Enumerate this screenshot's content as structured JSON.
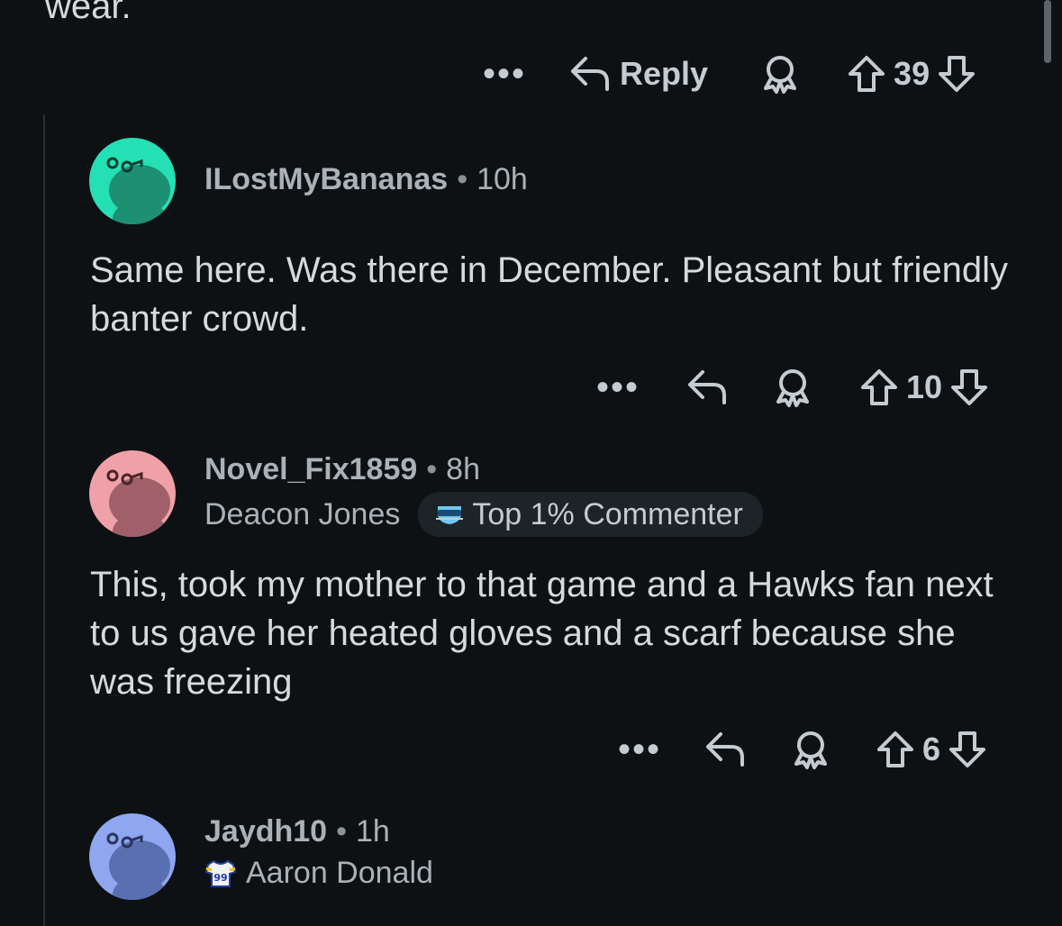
{
  "top_fragment": {
    "text": "wear."
  },
  "comments": [
    {
      "actions": {
        "more": "•••",
        "reply": "Reply",
        "votes": "39"
      }
    },
    {
      "username": "ILostMyBananas",
      "separator": "•",
      "time": "10h",
      "avatar_color": "#24e0b4",
      "body": "Same here. Was there in December. Pleasant but friendly banter crowd.",
      "actions": {
        "more": "•••",
        "votes": "10"
      }
    },
    {
      "username": "Novel_Fix1859",
      "separator": "•",
      "time": "8h",
      "flair": "Deacon Jones",
      "badge": "Top 1% Commenter",
      "avatar_color": "#f0a0a8",
      "body": "This, took my mother to that game and a Hawks fan next to us gave her heated gloves and a scarf because she was freezing",
      "actions": {
        "more": "•••",
        "votes": "6"
      }
    },
    {
      "username": "Jaydh10",
      "separator": "•",
      "time": "1h",
      "flair": "Aaron Donald",
      "flair_icon_text": "99",
      "avatar_color": "#8fa6f0"
    }
  ],
  "colors": {
    "background": "#0e1113",
    "text": "#d7dadc",
    "muted": "#aab2b7",
    "thread_line": "#2a3236"
  }
}
